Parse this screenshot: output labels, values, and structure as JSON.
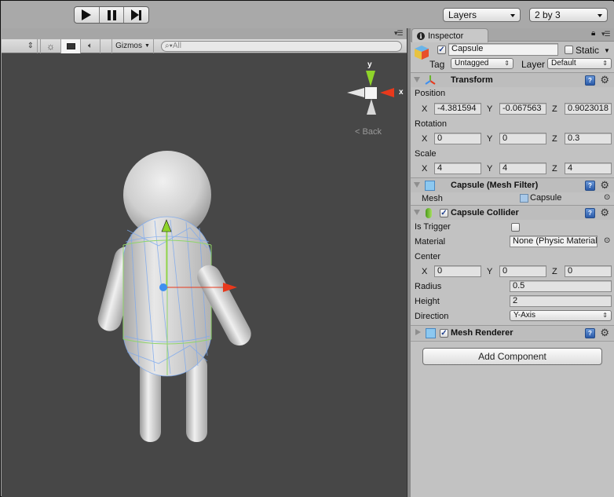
{
  "toolbar": {
    "play_icon": "play-icon",
    "pause_icon": "pause-icon",
    "step_icon": "step-icon",
    "layers_dropdown": "Layers",
    "layout_dropdown": "2 by 3"
  },
  "scene": {
    "toolbar": {
      "draw_mode_icon": "updown-arrows-icon",
      "lighting_icon": "sun-icon",
      "image_icon": "image-icon",
      "audio_icon": "speaker-icon",
      "gizmos_label": "Gizmos",
      "search_placeholder": "All"
    },
    "orientation_gizmo": {
      "y_label": "y",
      "x_label": "x",
      "back_label": "Back"
    }
  },
  "inspector": {
    "tab_label": "Inspector",
    "object": {
      "active": true,
      "name": "Capsule",
      "static_label": "Static",
      "static_checked": false,
      "tag_label": "Tag",
      "tag_value": "Untagged",
      "layer_label": "Layer",
      "layer_value": "Default"
    },
    "transform": {
      "title": "Transform",
      "position_label": "Position",
      "position": {
        "x": "-4.381594",
        "y": "-0.067563",
        "z": "0.9023018"
      },
      "rotation_label": "Rotation",
      "rotation": {
        "x": "0",
        "y": "0",
        "z": "0.3"
      },
      "scale_label": "Scale",
      "scale": {
        "x": "4",
        "y": "4",
        "z": "4"
      },
      "axis_labels": {
        "x": "X",
        "y": "Y",
        "z": "Z"
      }
    },
    "mesh_filter": {
      "title": "Capsule (Mesh Filter)",
      "mesh_label": "Mesh",
      "mesh_value": "Capsule"
    },
    "capsule_collider": {
      "title": "Capsule Collider",
      "enabled": true,
      "is_trigger_label": "Is Trigger",
      "is_trigger": false,
      "material_label": "Material",
      "material_value": "None (Physic Material)",
      "center_label": "Center",
      "center": {
        "x": "0",
        "y": "0",
        "z": "0"
      },
      "radius_label": "Radius",
      "radius": "0.5",
      "height_label": "Height",
      "height": "2",
      "direction_label": "Direction",
      "direction": "Y-Axis"
    },
    "mesh_renderer": {
      "title": "Mesh Renderer",
      "enabled": true
    },
    "add_component_label": "Add Component"
  },
  "colors": {
    "viewport_bg": "#474747",
    "inspector_bg": "#c2c2c2",
    "gizmo_x": "#e8391c",
    "gizmo_y": "#8fd42a",
    "gizmo_z": "#3f8ff0",
    "collider_wire": "#8fd46a",
    "mesh_wire": "#7aa8f0"
  }
}
